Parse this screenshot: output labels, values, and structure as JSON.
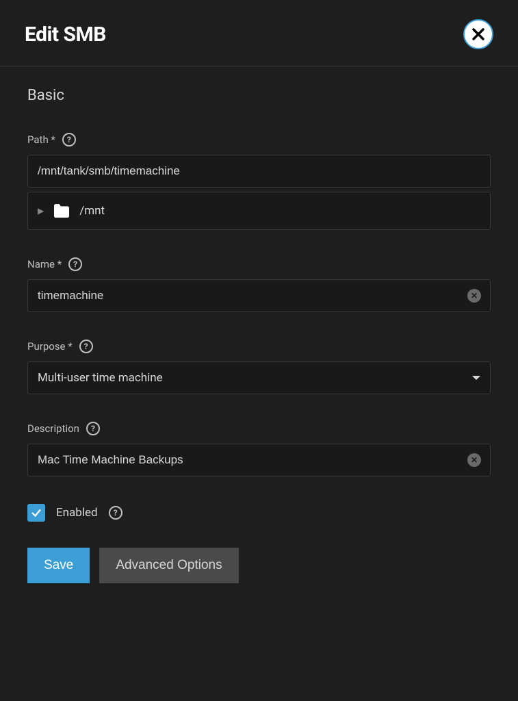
{
  "header": {
    "title": "Edit SMB"
  },
  "section": {
    "title": "Basic"
  },
  "fields": {
    "path": {
      "label": "Path *",
      "value": "/mnt/tank/smb/timemachine",
      "tree_item": "/mnt"
    },
    "name": {
      "label": "Name *",
      "value": "timemachine"
    },
    "purpose": {
      "label": "Purpose *",
      "value": "Multi-user time machine"
    },
    "description": {
      "label": "Description",
      "value": "Mac Time Machine Backups"
    },
    "enabled": {
      "label": "Enabled",
      "checked": true
    }
  },
  "buttons": {
    "save": "Save",
    "advanced": "Advanced Options"
  },
  "help": "?"
}
